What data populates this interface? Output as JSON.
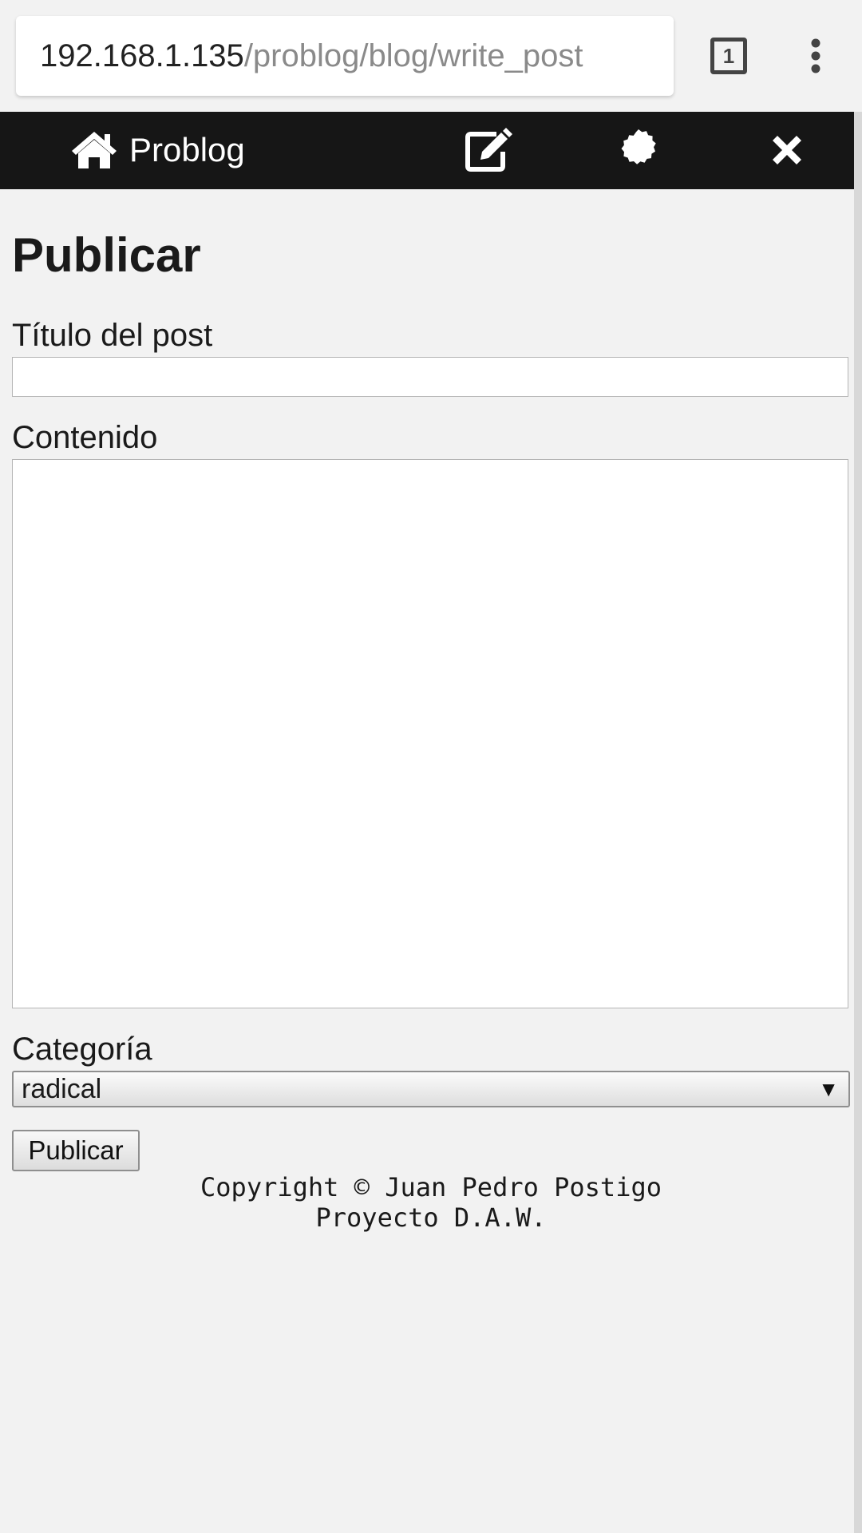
{
  "browser": {
    "url_host": "192.168.1.135",
    "url_path": "/problog/blog/write_post",
    "tab_count": "1",
    "icons": [
      "tabs-icon",
      "overflow-menu-icon"
    ]
  },
  "navbar": {
    "brand_label": "Problog",
    "icons": [
      "home-icon",
      "edit-icon",
      "gear-icon",
      "close-icon"
    ]
  },
  "form": {
    "title": "Publicar",
    "titulo_label": "Título del post",
    "titulo_value": "",
    "contenido_label": "Contenido",
    "contenido_value": "",
    "categoria_label": "Categoría",
    "categoria_selected": "radical",
    "submit_label": "Publicar"
  },
  "footer": {
    "line1": "Copyright © Juan Pedro Postigo",
    "line2": "Proyecto D.A.W."
  },
  "colors": {
    "navbar_bg": "#161616",
    "page_bg": "#f2f2f2",
    "text": "#1a1a1a"
  }
}
